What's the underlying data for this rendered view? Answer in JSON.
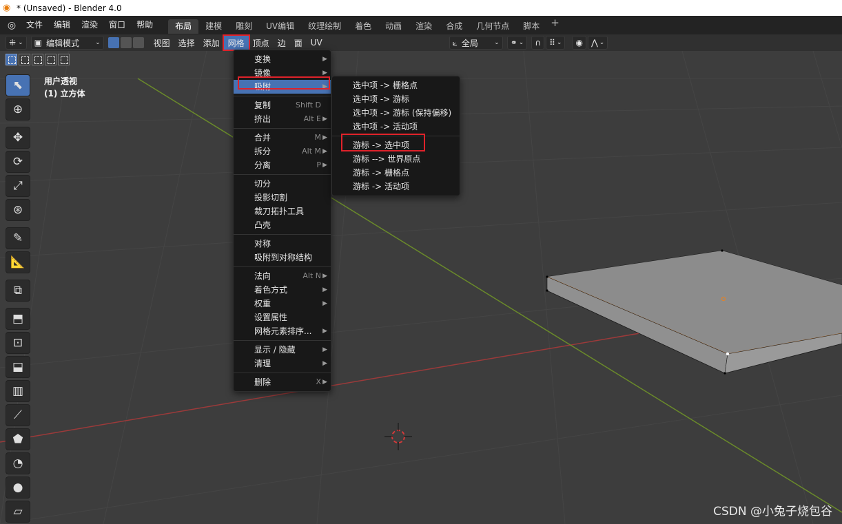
{
  "window": {
    "title": "* (Unsaved) - Blender 4.0"
  },
  "topbar": {
    "menus": [
      "文件",
      "编辑",
      "渲染",
      "窗口",
      "帮助"
    ],
    "workspaces": [
      "布局",
      "建模",
      "雕刻",
      "UV编辑",
      "纹理绘制",
      "着色",
      "动画",
      "渲染",
      "合成",
      "几何节点",
      "脚本"
    ],
    "active_workspace": "布局",
    "add_tab": "+"
  },
  "header": {
    "mode": "编辑模式",
    "menus": [
      "视图",
      "选择",
      "添加",
      "网格",
      "顶点",
      "边",
      "面",
      "UV"
    ],
    "active_menu": "网格",
    "transform_orientation": "全局"
  },
  "viewport": {
    "label_line1": "用户透视",
    "label_line2": "(1) 立方体"
  },
  "mesh_menu": {
    "items": [
      {
        "label": "变换",
        "shortcut": "",
        "submenu": true
      },
      {
        "label": "镜像",
        "shortcut": "",
        "submenu": true
      },
      {
        "label": "吸附",
        "shortcut": "",
        "submenu": true,
        "highlighted": true
      },
      {
        "sep": true
      },
      {
        "label": "复制",
        "shortcut": "Shift D",
        "submenu": false
      },
      {
        "label": "挤出",
        "shortcut": "Alt E",
        "submenu": true
      },
      {
        "sep": true
      },
      {
        "label": "合并",
        "shortcut": "M",
        "submenu": true
      },
      {
        "label": "拆分",
        "shortcut": "Alt M",
        "submenu": true
      },
      {
        "label": "分离",
        "shortcut": "P",
        "submenu": true
      },
      {
        "sep": true
      },
      {
        "label": "切分",
        "shortcut": "",
        "submenu": false
      },
      {
        "label": "投影切割",
        "shortcut": "",
        "submenu": false
      },
      {
        "label": "裁刀拓扑工具",
        "shortcut": "",
        "submenu": false
      },
      {
        "label": "凸壳",
        "shortcut": "",
        "submenu": false
      },
      {
        "sep": true
      },
      {
        "label": "对称",
        "shortcut": "",
        "submenu": false
      },
      {
        "label": "吸附到对称结构",
        "shortcut": "",
        "submenu": false
      },
      {
        "sep": true
      },
      {
        "label": "法向",
        "shortcut": "Alt N",
        "submenu": true
      },
      {
        "label": "着色方式",
        "shortcut": "",
        "submenu": true
      },
      {
        "label": "权重",
        "shortcut": "",
        "submenu": true
      },
      {
        "label": "设置属性",
        "shortcut": "",
        "submenu": false
      },
      {
        "label": "网格元素排序...",
        "shortcut": "",
        "submenu": true
      },
      {
        "sep": true
      },
      {
        "label": "显示 / 隐藏",
        "shortcut": "",
        "submenu": true
      },
      {
        "label": "清理",
        "shortcut": "",
        "submenu": true
      },
      {
        "sep": true
      },
      {
        "label": "删除",
        "shortcut": "X",
        "submenu": true
      }
    ]
  },
  "snap_submenu": {
    "items": [
      {
        "label": "选中项 -> 栅格点"
      },
      {
        "label": "选中项 -> 游标"
      },
      {
        "label": "选中项 -> 游标 (保持偏移)"
      },
      {
        "label": "选中项 -> 活动项"
      },
      {
        "sep": true
      },
      {
        "label": "游标 -> 选中项"
      },
      {
        "label": "游标 --> 世界原点"
      },
      {
        "label": "游标 -> 栅格点"
      },
      {
        "label": "游标 -> 活动项"
      }
    ]
  },
  "watermark": "CSDN @小兔子烧包谷",
  "colors": {
    "accent": "#4772b3",
    "highlight_outline": "#e0222a",
    "x_axis": "#9c3a3a",
    "y_axis": "#6a8a2a",
    "mesh_face": "#8a8a8a",
    "selected_edge": "#e0822a"
  }
}
